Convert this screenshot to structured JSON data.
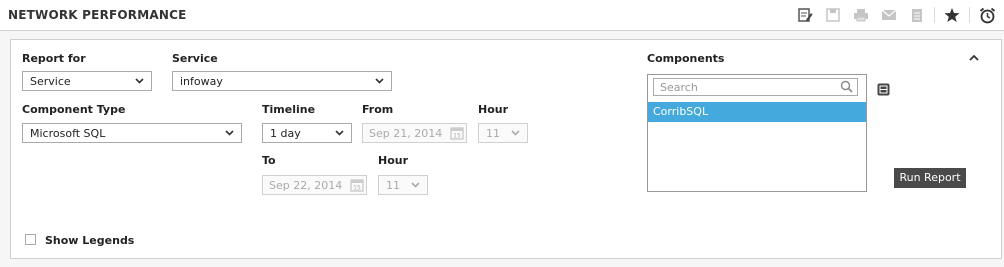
{
  "header": {
    "title": "NETWORK PERFORMANCE",
    "toolbar": [
      "edit-report-icon",
      "save-icon",
      "print-icon",
      "mail-icon",
      "pdf-icon",
      "favorite-icon",
      "schedule-icon"
    ]
  },
  "form": {
    "report_for": {
      "label": "Report for",
      "value": "Service"
    },
    "service": {
      "label": "Service",
      "value": "infoway"
    },
    "component_type": {
      "label": "Component Type",
      "value": "Microsoft SQL"
    },
    "timeline": {
      "label": "Timeline",
      "value": "1 day"
    },
    "from": {
      "label": "From",
      "date": "Sep 21, 2014"
    },
    "from_hour": {
      "label": "Hour",
      "value": "11"
    },
    "to": {
      "label": "To",
      "date": "Sep 22, 2014"
    },
    "to_hour": {
      "label": "Hour",
      "value": "11"
    },
    "components": {
      "label": "Components",
      "search_placeholder": "Search",
      "items": [
        {
          "label": "CorribSQL",
          "selected": true
        }
      ]
    },
    "run_report": "Run Report",
    "show_legends": {
      "label": "Show Legends",
      "checked": false
    }
  },
  "colors": {
    "accent": "#44a9dc",
    "button": "#4a4a4a"
  }
}
